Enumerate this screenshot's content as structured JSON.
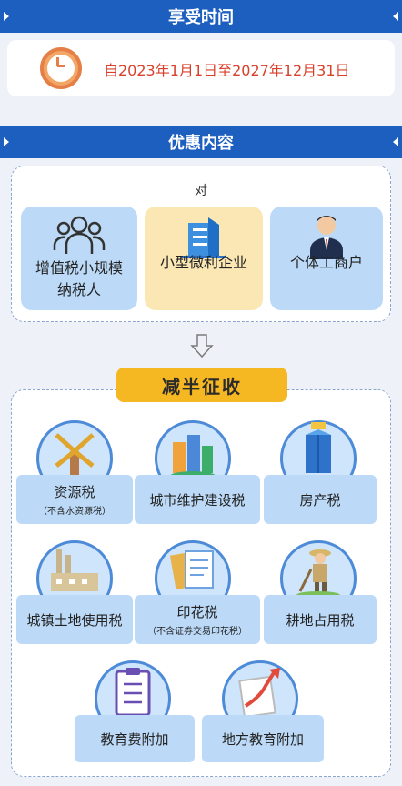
{
  "period": {
    "header": "享受时间",
    "date_text": "自2023年1月1日至2027年12月31日"
  },
  "content": {
    "header": "优惠内容",
    "to_label": "对",
    "taxpayers": [
      {
        "label_line1": "增值税小规模",
        "label_line2": "纳税人",
        "icon": "people-icon"
      },
      {
        "label_line1": "小型微利企业",
        "label_line2": "",
        "icon": "building-icon"
      },
      {
        "label_line1": "个体工商户",
        "label_line2": "",
        "icon": "businessman-icon"
      }
    ],
    "half_levy": "减半征收",
    "taxes": [
      {
        "name": "资源税",
        "note": "（不含水资源税）",
        "icon": "windmill-icon"
      },
      {
        "name": "城市维护建设税",
        "note": "",
        "icon": "city-icon"
      },
      {
        "name": "房产税",
        "note": "",
        "icon": "tower-icon"
      },
      {
        "name": "城镇土地使用税",
        "note": "",
        "icon": "factory-icon"
      },
      {
        "name": "印花税",
        "note": "（不含证券交易印花税）",
        "icon": "documents-icon"
      },
      {
        "name": "耕地占用税",
        "note": "",
        "icon": "farmer-icon"
      },
      {
        "name": "教育费附加",
        "note": "",
        "icon": "clipboard-icon"
      },
      {
        "name": "地方教育附加",
        "note": "",
        "icon": "paper-arrow-icon"
      }
    ]
  },
  "colors": {
    "header_blue": "#1d5fbf",
    "card_blue": "#bcdaf7",
    "card_yellow": "#fbe7b4",
    "tag_yellow": "#f5b722",
    "date_red": "#d9402b"
  }
}
